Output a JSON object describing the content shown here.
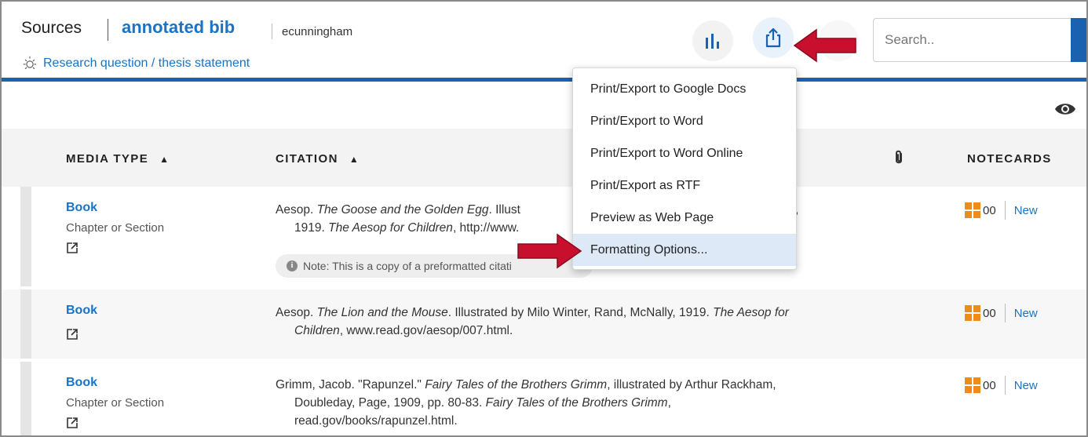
{
  "header": {
    "section_title": "Sources",
    "project_name": "annotated bib",
    "username": "ecunningham",
    "research_link": "Research question / thesis statement",
    "search_placeholder": "Search.."
  },
  "toolbar": {
    "stats_icon": "bar-chart-icon",
    "export_icon": "share-export-icon",
    "visibility_icon": "eye-icon"
  },
  "export_menu": {
    "items": [
      "Print/Export to Google Docs",
      "Print/Export to Word",
      "Print/Export to Word Online",
      "Print/Export as RTF",
      "Preview as Web Page",
      "Formatting Options..."
    ],
    "highlighted": "Formatting Options..."
  },
  "table": {
    "columns": {
      "media_type": "MEDIA TYPE",
      "citation": "CITATION",
      "attachments_icon": "paperclip-icon",
      "notecards": "NOTECARDS"
    },
    "sort": {
      "media_type": "unsorted",
      "citation": "ascending"
    },
    "rows": [
      {
        "media_type": "Book",
        "media_subtype": "Chapter or Section",
        "citation_parts": [
          {
            "text": "Aesop. ",
            "italic": false
          },
          {
            "text": "The Goose and the Golden Egg",
            "italic": true
          },
          {
            "text": ". Illust",
            "italic": false
          }
        ],
        "citation_tail_visible": "ly,",
        "citation_line2_parts": [
          {
            "text": "1919. ",
            "italic": false
          },
          {
            "text": "The Aesop for Children",
            "italic": true
          },
          {
            "text": ", http://www.",
            "italic": false
          }
        ],
        "note": "Note: This is a copy of a preformatted citati",
        "notecard_count": "00",
        "notecard_new": "New"
      },
      {
        "media_type": "Book",
        "media_subtype": "",
        "citation_parts": [
          {
            "text": "Aesop. ",
            "italic": false
          },
          {
            "text": "The Lion and the Mouse",
            "italic": true
          },
          {
            "text": ". Illustrated by Milo Winter, Rand, McNally, 1919. ",
            "italic": false
          },
          {
            "text": "The Aesop for Children",
            "italic": true
          },
          {
            "text": ", www.read.gov/aesop/007.html.",
            "italic": false
          }
        ],
        "note": "",
        "notecard_count": "00",
        "notecard_new": "New"
      },
      {
        "media_type": "Book",
        "media_subtype": "Chapter or Section",
        "citation_parts": [
          {
            "text": "Grimm, Jacob. \"Rapunzel.\" ",
            "italic": false
          },
          {
            "text": "Fairy Tales of the Brothers Grimm",
            "italic": true
          },
          {
            "text": ", illustrated by Arthur Rackham, Doubleday, Page, 1909, pp. 80-83. ",
            "italic": false
          },
          {
            "text": "Fairy Tales of the Brothers Grimm",
            "italic": true
          },
          {
            "text": ", read.gov/books/rapunzel.html.",
            "italic": false
          }
        ],
        "note": "",
        "notecard_count": "00",
        "notecard_new": "New"
      }
    ]
  },
  "colors": {
    "link_blue": "#1a73c5",
    "accent_bar": "#1a62b0",
    "notecard_orange": "#f08a18",
    "annotation_arrow": "#c8102e",
    "menu_highlight": "#dde9f7"
  }
}
